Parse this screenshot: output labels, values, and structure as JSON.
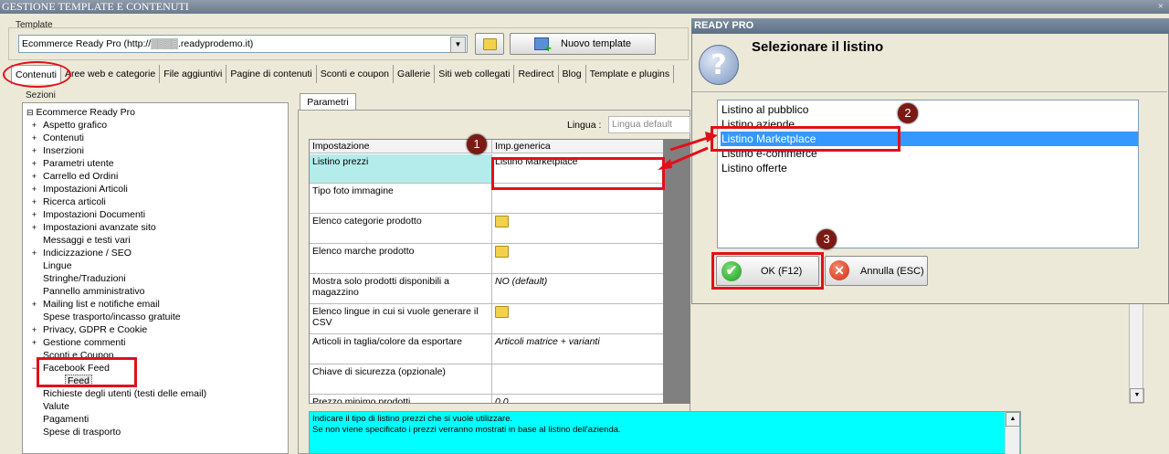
{
  "window": {
    "title": "GESTIONE TEMPLATE E CONTENUTI",
    "close": "×"
  },
  "template": {
    "label": "Template",
    "selected": "Ecommerce Ready Pro (http://▒▒▒▒.readyprodemo.it)",
    "new_button": "Nuovo template"
  },
  "tabs": [
    "Contenuti",
    "Aree web e categorie",
    "File aggiuntivi",
    "Pagine di contenuti",
    "Sconti e coupon",
    "Gallerie",
    "Siti web collegati",
    "Redirect",
    "Blog",
    "Template e plugins"
  ],
  "sections": {
    "label": "Sezioni",
    "root": "Ecommerce Ready Pro",
    "items": [
      {
        "label": "Aspetto grafico",
        "expand": "+"
      },
      {
        "label": "Contenuti",
        "expand": "+"
      },
      {
        "label": "Inserzioni",
        "expand": "+"
      },
      {
        "label": "Parametri utente",
        "expand": "+"
      },
      {
        "label": "Carrello ed Ordini",
        "expand": "+"
      },
      {
        "label": "Impostazioni Articoli",
        "expand": "+"
      },
      {
        "label": "Ricerca articoli",
        "expand": "+"
      },
      {
        "label": "Impostazioni Documenti",
        "expand": "+"
      },
      {
        "label": "Impostazioni avanzate sito",
        "expand": "+"
      },
      {
        "label": "Messaggi e testi vari",
        "expand": ""
      },
      {
        "label": "Indicizzazione / SEO",
        "expand": "+"
      },
      {
        "label": "Lingue",
        "expand": ""
      },
      {
        "label": "Stringhe/Traduzioni",
        "expand": ""
      },
      {
        "label": "Pannello amministrativo",
        "expand": ""
      },
      {
        "label": "Mailing list e notifiche email",
        "expand": "+"
      },
      {
        "label": "Spese trasporto/incasso gratuite",
        "expand": ""
      },
      {
        "label": "Privacy, GDPR e Cookie",
        "expand": "+"
      },
      {
        "label": "Gestione commenti",
        "expand": "+"
      },
      {
        "label": "Sconti e Coupon",
        "expand": ""
      },
      {
        "label": "Facebook Feed",
        "expand": "−"
      },
      {
        "label": "Feed",
        "expand": ""
      },
      {
        "label": "Richieste degli utenti (testi delle email)",
        "expand": ""
      },
      {
        "label": "Valute",
        "expand": ""
      },
      {
        "label": "Pagamenti",
        "expand": ""
      },
      {
        "label": "Spese di trasporto",
        "expand": ""
      }
    ]
  },
  "params": {
    "tab": "Parametri",
    "language_label": "Lingua :",
    "language_value": "Lingua default",
    "col_setting": "Impostazione",
    "col_value": "Imp.generica",
    "rows": [
      {
        "setting": "Listino prezzi",
        "value": "Listino Marketplace"
      },
      {
        "setting": "Tipo foto immagine",
        "value": ""
      },
      {
        "setting": "Elenco categorie prodotto",
        "value": ""
      },
      {
        "setting": "Elenco marche prodotto",
        "value": ""
      },
      {
        "setting": "Mostra solo prodotti disponibili a magazzino",
        "value": "NO (default)"
      },
      {
        "setting": "Elenco lingue in cui si vuole generare il CSV",
        "value": ""
      },
      {
        "setting": "Articoli in taglia/colore da esportare",
        "value": "Articoli matrice + varianti"
      },
      {
        "setting": "Chiave di sicurezza (opzionale)",
        "value": ""
      },
      {
        "setting": "Prezzo minimo prodotti",
        "value": "0,0"
      }
    ],
    "description": [
      "Indicare il tipo di listino prezzi che si vuole utilizzare.",
      "Se non viene specificato i prezzi verranno mostrati in base al listino dell'azienda."
    ]
  },
  "dialog": {
    "title": "READY PRO",
    "heading": "Selezionare il listino",
    "options": [
      "Listino al pubblico",
      "Listino aziende",
      "Listino Marketplace",
      "Listino e-commerce",
      "Listino offerte"
    ],
    "selected_index": 2,
    "ok": "OK (F12)",
    "cancel": "Annulla (ESC)"
  },
  "annotations": {
    "b1": "1",
    "b2": "2",
    "b3": "3"
  },
  "colors": {
    "highlight_cell": "#b4ecec",
    "description_bg": "#00ffff",
    "selection": "#3399ff",
    "callout": "#e0101a"
  }
}
